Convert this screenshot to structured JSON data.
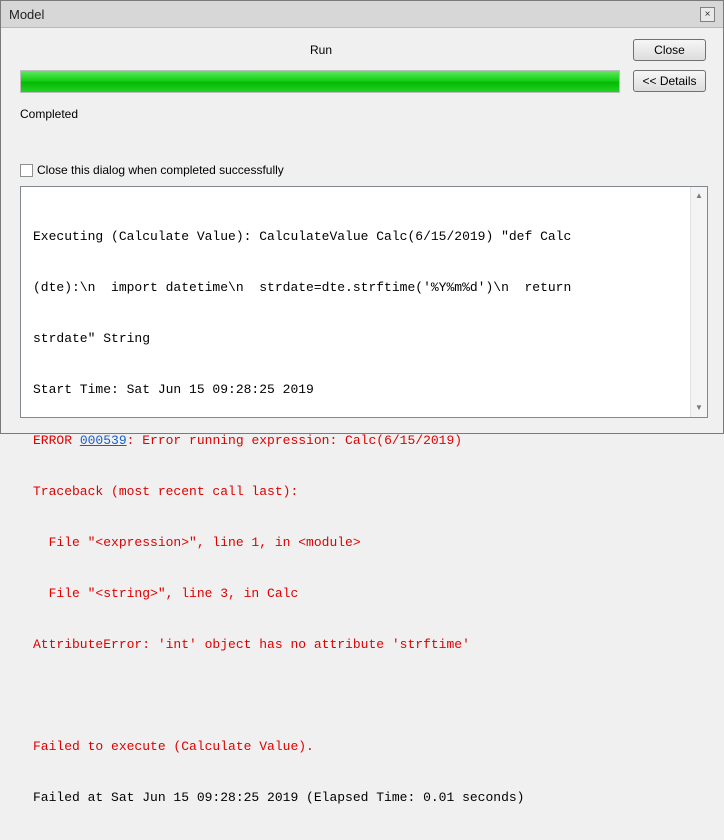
{
  "window": {
    "title": "Model",
    "close_icon": "×"
  },
  "run_label": "Run",
  "buttons": {
    "close": "Close",
    "details": "<< Details"
  },
  "progress": {
    "value_percent": 100
  },
  "status_text": "Completed",
  "checkbox": {
    "label": "Close this dialog when completed successfully",
    "checked": false
  },
  "log": {
    "line1": "Executing (Calculate Value): CalculateValue Calc(6/15/2019) \"def Calc",
    "line2": "(dte):\\n  import datetime\\n  strdate=dte.strftime('%Y%m%d')\\n  return",
    "line3": "strdate\" String",
    "line4": "Start Time: Sat Jun 15 09:28:25 2019",
    "error_prefix": "ERROR ",
    "error_code": "000539",
    "error_rest": ": Error running expression: Calc(6/15/2019)",
    "line6": "Traceback (most recent call last):",
    "line7": "  File \"<expression>\", line 1, in <module>",
    "line8": "  File \"<string>\", line 3, in Calc",
    "line9": "AttributeError: 'int' object has no attribute 'strftime'",
    "line11": "Failed to execute (Calculate Value).",
    "line12": "Failed at Sat Jun 15 09:28:25 2019 (Elapsed Time: 0.01 seconds)"
  },
  "scrollbar": {
    "up_icon": "▲",
    "down_icon": "▼"
  },
  "colors": {
    "progress_green": "#16cf16",
    "error_red": "#e00000",
    "link_blue": "#1a5ec9"
  }
}
